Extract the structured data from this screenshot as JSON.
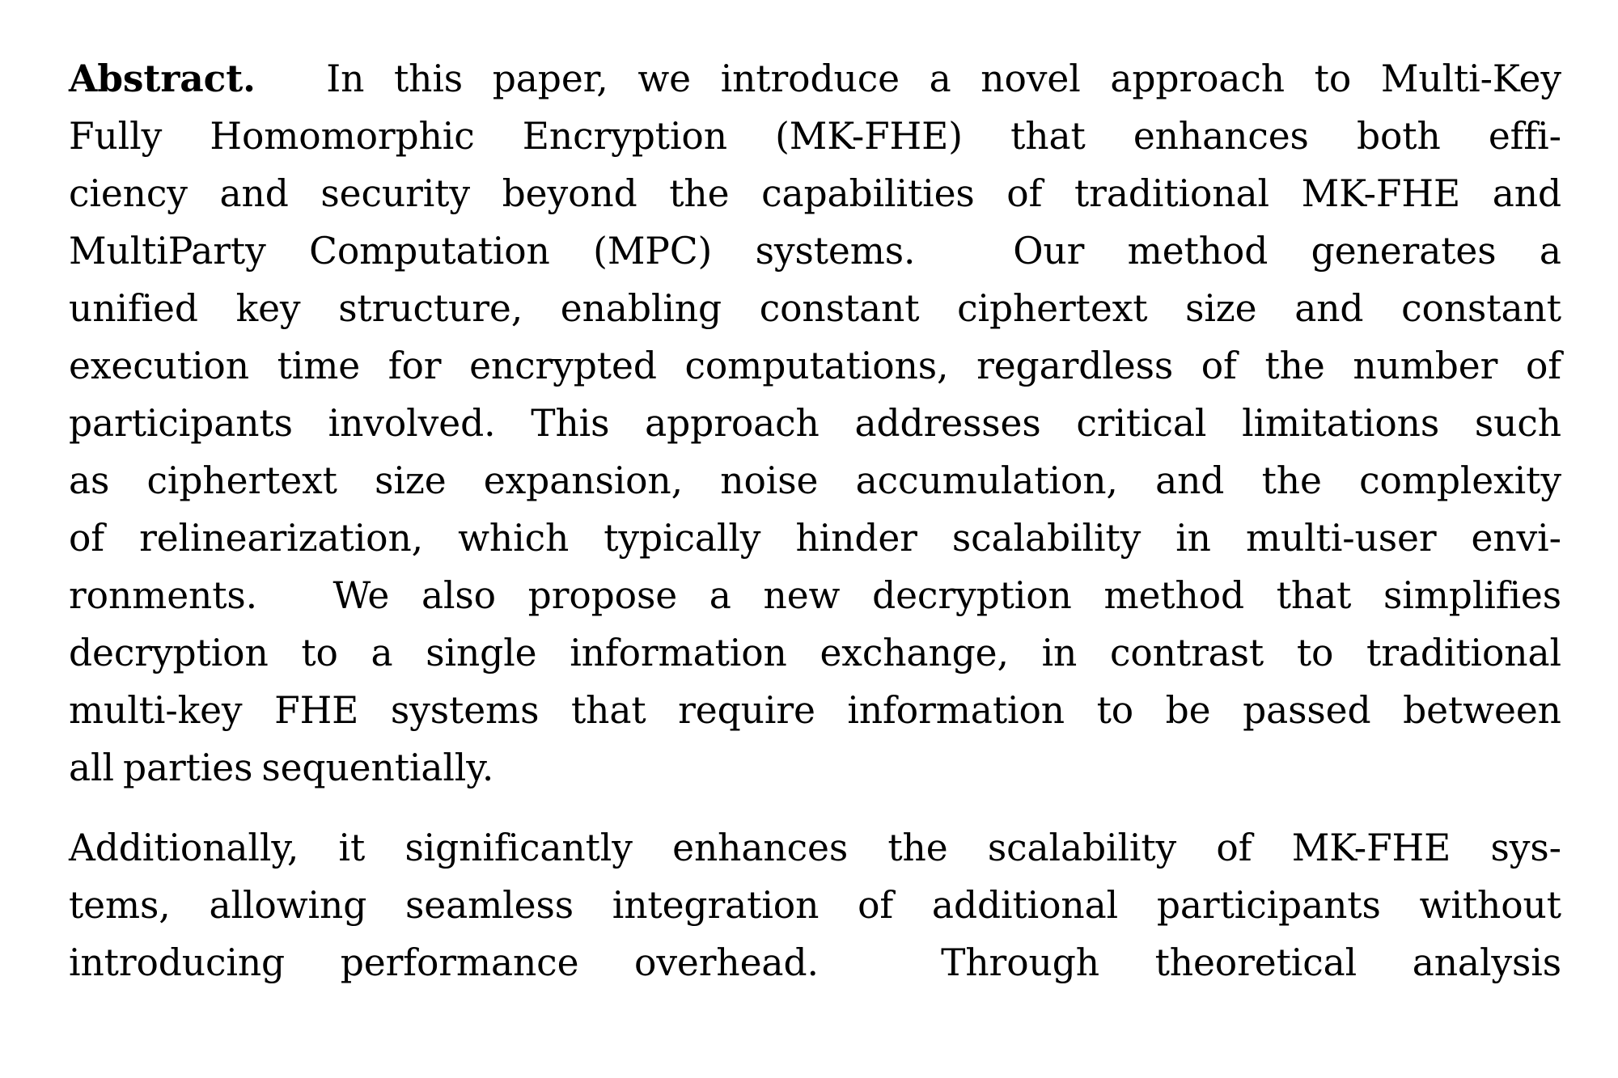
{
  "document": {
    "section_label": "Abstract.",
    "background_color": "#ffffff",
    "text_color": "#000000",
    "paragraphs": [
      {
        "id": "abstract-paragraph",
        "lines": [
          {
            "id": "l1",
            "justified": true,
            "text": "Abstract.  In this paper, we introduce a novel approach to Multi-Key",
            "lead_bold": "Abstract."
          },
          {
            "id": "l2",
            "justified": true,
            "text": "Fully Homomorphic Encryption (MK-FHE) that enhances both effi-"
          },
          {
            "id": "l3",
            "justified": true,
            "text": "ciency and security beyond the capabilities of traditional MK-FHE and"
          },
          {
            "id": "l4",
            "justified": true,
            "text": "MultiParty Computation (MPC) systems.  Our method generates a"
          },
          {
            "id": "l5",
            "justified": true,
            "text": "unified key structure, enabling constant ciphertext size and constant"
          },
          {
            "id": "l6",
            "justified": true,
            "text": "execution time for encrypted computations, regardless of the number of"
          },
          {
            "id": "l7",
            "justified": true,
            "text": "participants involved. This approach addresses critical limitations such"
          },
          {
            "id": "l8",
            "justified": true,
            "text": "as ciphertext size expansion, noise accumulation, and the complexity"
          },
          {
            "id": "l9",
            "justified": true,
            "text": "of relinearization, which typically hinder scalability in multi-user envi-"
          },
          {
            "id": "l10",
            "justified": true,
            "text": "ronments.  We also propose a new decryption method that simplifies"
          },
          {
            "id": "l11",
            "justified": true,
            "text": "decryption to a single information exchange, in contrast to traditional"
          },
          {
            "id": "l12",
            "justified": true,
            "text": "multi-key FHE systems that require information to be passed between"
          },
          {
            "id": "l13",
            "justified": false,
            "text": "all parties sequentially."
          }
        ]
      },
      {
        "id": "additional-paragraph",
        "lines": [
          {
            "id": "l14",
            "justified": true,
            "text": "Additionally, it significantly enhances the scalability of MK-FHE sys-"
          },
          {
            "id": "l15",
            "justified": true,
            "text": "tems, allowing seamless integration of additional participants without"
          },
          {
            "id": "l16",
            "justified": true,
            "text": "introducing performance overhead.  Through theoretical analysis"
          }
        ]
      }
    ]
  }
}
